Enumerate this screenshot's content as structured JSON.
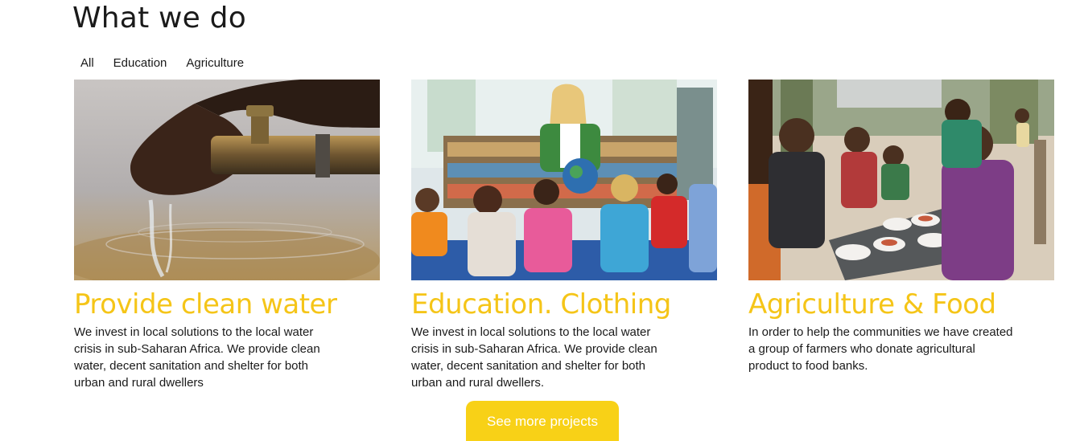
{
  "section": {
    "title": "What we do"
  },
  "filters": [
    {
      "label": "All"
    },
    {
      "label": "Education"
    },
    {
      "label": "Agriculture"
    }
  ],
  "cards": [
    {
      "title": "Provide clean water",
      "text": "We invest in local solutions to the local water crisis in sub-Saharan Africa. We provide clean water, decent sanitation and shelter for both urban and rural dwellers",
      "image": "water-tap-photo"
    },
    {
      "title": "Education. Clothing",
      "text": "We invest in local solutions to the local water crisis in sub-Saharan Africa. We provide clean water, decent sanitation and shelter for both urban and rural dwellers.",
      "image": "classroom-photo"
    },
    {
      "title": "Agriculture & Food",
      "text": "In order to help the communities we have created a group of farmers who donate agricultural product to food banks.",
      "image": "children-food-photo"
    }
  ],
  "more_button": {
    "label": "See more projects"
  },
  "colors": {
    "accent": "#f5c518",
    "button": "#f8d117"
  }
}
